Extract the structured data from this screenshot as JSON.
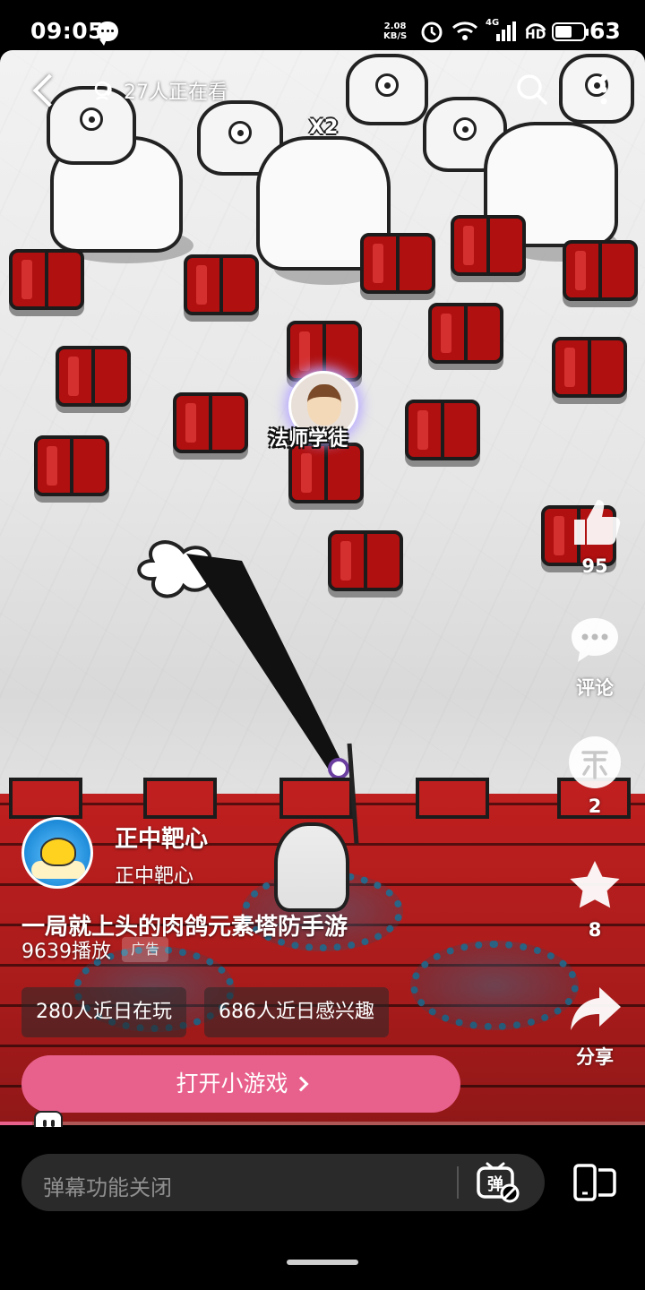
{
  "status_bar": {
    "time": "09:05",
    "net_speed_value": "2.08",
    "net_speed_unit": "KB/S",
    "signal_label": "4G",
    "hd_label": "HD",
    "battery": "63",
    "icons": [
      "chat-bubble-icon",
      "alarm-icon",
      "wifi-icon",
      "signal-icon",
      "hd-icon",
      "battery-icon"
    ]
  },
  "top_bar": {
    "viewers": "27人正在看",
    "icons": [
      "back-icon",
      "viewers-icon",
      "search-icon",
      "more-icon"
    ]
  },
  "video": {
    "multiplier": "X2",
    "unit_label": "法师学徒"
  },
  "actions": {
    "like_count": "95",
    "comment_label": "评论",
    "coin_count": "2",
    "favorite_count": "8",
    "share_label": "分享"
  },
  "author": {
    "name": "正中靶心",
    "subtitle": "正中靶心"
  },
  "post": {
    "title": "一局就上头的肉鸽元素塔防手游",
    "plays": "9639播放",
    "ad_tag": "广告",
    "chip_playing": "280人近日在玩",
    "chip_interest": "686人近日感兴趣",
    "open_button": "打开小游戏"
  },
  "progress": {
    "fraction": 0.05
  },
  "danmaku": {
    "placeholder": "弹幕功能关闭",
    "toggle_glyph": "弹"
  },
  "colors": {
    "accent_pink": "#e8608c",
    "wall_red": "#c01f1f",
    "crate_red": "#b01010"
  }
}
